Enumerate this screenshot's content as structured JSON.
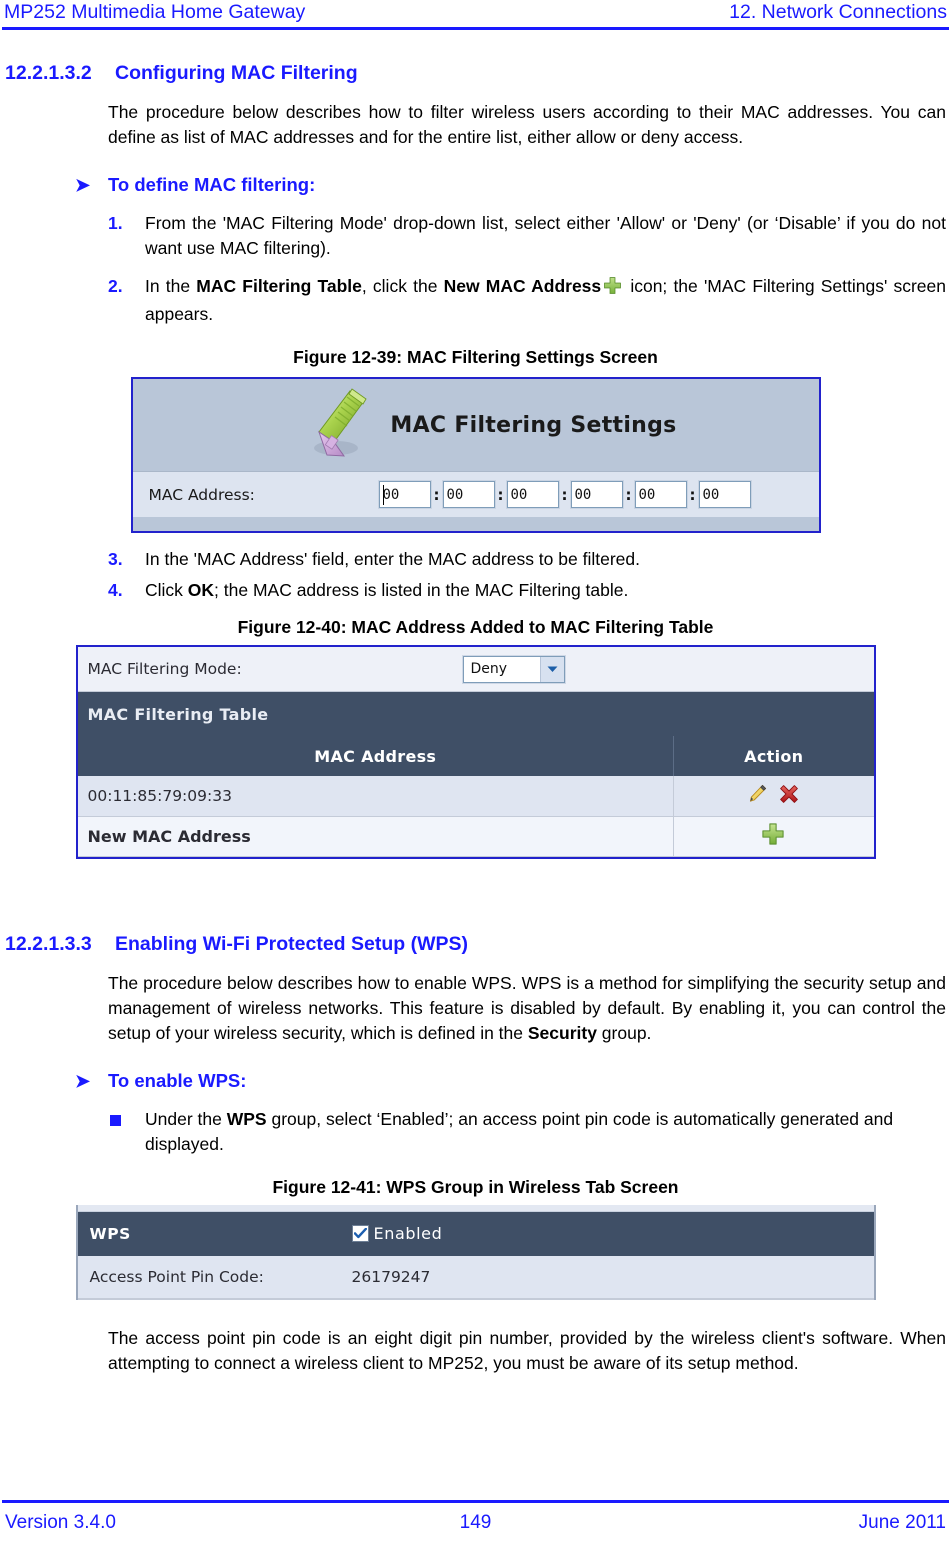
{
  "header": {
    "left": "MP252 Multimedia Home Gateway",
    "right": "12. Network Connections"
  },
  "footer": {
    "version": "Version 3.4.0",
    "page_number": "149",
    "date": "June 2011"
  },
  "sections": [
    {
      "number": "12.2.1.3.2",
      "title": "Configuring MAC Filtering",
      "intro": "The procedure below describes how to filter wireless users according to their MAC addresses. You can define as list of MAC addresses and for the entire list, either allow or deny access.",
      "procedure_title": "To define MAC filtering:",
      "steps": [
        {
          "num": "1.",
          "parts": [
            {
              "text": "From the 'MAC Filtering Mode' drop-down list, select either 'Allow' or 'Deny' (or ‘Disable’ if you do not want use MAC filtering).",
              "bold": false
            }
          ]
        },
        {
          "num": "2.",
          "parts": [
            {
              "text": "In the ",
              "bold": false
            },
            {
              "text": "MAC Filtering Table",
              "bold": true
            },
            {
              "text": ", click the ",
              "bold": false
            },
            {
              "text": "New MAC Address",
              "bold": true
            },
            {
              "icon": "plus-icon"
            },
            {
              "text": " icon; the 'MAC Filtering Settings' screen appears.",
              "bold": false
            }
          ]
        },
        {
          "num": "3.",
          "parts": [
            {
              "text": "In the 'MAC Address' field, enter the MAC address to be filtered.",
              "bold": false
            }
          ]
        },
        {
          "num": "4.",
          "parts": [
            {
              "text": "Click ",
              "bold": false
            },
            {
              "text": "OK",
              "bold": true
            },
            {
              "text": "; the MAC address is listed in the MAC Filtering table.",
              "bold": false
            }
          ]
        }
      ]
    },
    {
      "number": "12.2.1.3.3",
      "title": "Enabling Wi-Fi Protected Setup (WPS)",
      "intro_parts": [
        {
          "text": "The procedure below describes how to enable WPS. WPS is a method for simplifying the security setup and management of wireless networks. This feature is disabled by default. By enabling it, you can control the setup of your wireless security, which is defined in the ",
          "bold": false
        },
        {
          "text": "Security",
          "bold": true
        },
        {
          "text": " group.",
          "bold": false
        }
      ],
      "procedure_title": "To enable WPS:",
      "bullets": [
        {
          "parts": [
            {
              "text": "Under the ",
              "bold": false
            },
            {
              "text": "WPS",
              "bold": true
            },
            {
              "text": " group, select ‘Enabled’; an access point pin code is automatically generated and displayed.",
              "bold": false
            }
          ]
        }
      ],
      "closing": "The access point pin code is an eight digit pin number, provided by the wireless client's software. When attempting to connect a wireless client to MP252, you must be aware of its setup method."
    }
  ],
  "figures": {
    "fig39": {
      "caption": "Figure 12-39: MAC Filtering Settings Screen",
      "panel_title": "MAC Filtering Settings",
      "icon_name": "rj45-connector-icon",
      "field_label": "MAC Address:",
      "octets": [
        "00",
        "00",
        "00",
        "00",
        "00",
        "00"
      ],
      "separator": ":",
      "colors": {
        "panel_bg": "#b9c6d8",
        "field_bg": "#dde4f0",
        "border": "#2222cc"
      }
    },
    "fig40": {
      "caption": "Figure 12-40: MAC Address Added to MAC Filtering Table",
      "mode_label": "MAC Filtering Mode:",
      "mode_value": "Deny",
      "group_title": "MAC Filtering Table",
      "columns": [
        "MAC Address",
        "Action"
      ],
      "rows": [
        {
          "mac": "00:11:85:79:09:33",
          "actions": [
            "edit-pencil-icon",
            "delete-x-icon"
          ]
        },
        {
          "mac": "New MAC Address",
          "actions": [
            "add-plus-icon"
          ]
        }
      ],
      "colors": {
        "header_bg": "#3f4f66",
        "row_bg": "#dfe5f1",
        "border": "#2222cc"
      }
    },
    "fig41": {
      "caption": "Figure 12-41: WPS Group in Wireless Tab Screen",
      "group_label": "WPS",
      "checkbox_label": "Enabled",
      "checkbox_checked": true,
      "pin_label": "Access Point Pin Code:",
      "pin_value": "26179247",
      "colors": {
        "header_bg": "#3f4f66",
        "row_bg": "#dfe5f1"
      }
    }
  }
}
